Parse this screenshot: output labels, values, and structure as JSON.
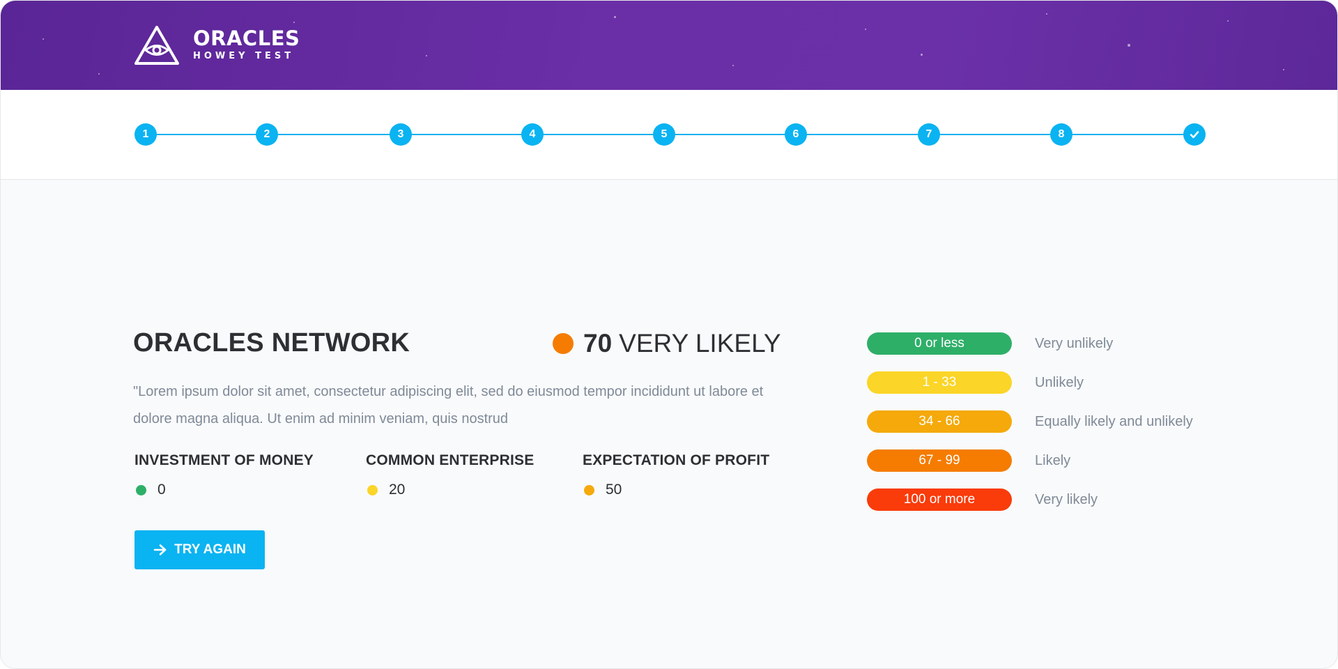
{
  "header": {
    "logo_title": "ORACLES",
    "logo_subtitle": "HOWEY TEST",
    "background_color": "#6a2ea6"
  },
  "stepper": {
    "steps": [
      "1",
      "2",
      "3",
      "4",
      "5",
      "6",
      "7",
      "8",
      "check-icon"
    ],
    "accent_color": "#0ab3f1"
  },
  "result": {
    "company": "ORACLES NETWORK",
    "score": "70",
    "verdict": "VERY LIKELY",
    "verdict_color": "#f57c00",
    "description": "\"Lorem ipsum dolor sit amet, consectetur adipiscing elit, sed do eiusmod tempor incididunt ut labore et dolore magna aliqua. Ut enim ad minim veniam, quis nostrud"
  },
  "criteria": [
    {
      "title": "INVESTMENT OF MONEY",
      "value": "0",
      "color": "#2eaf68"
    },
    {
      "title": "COMMON ENTERPRISE",
      "value": "20",
      "color": "#fbd527"
    },
    {
      "title": "EXPECTATION OF PROFIT",
      "value": "50",
      "color": "#f5a90a"
    }
  ],
  "try_again_label": "TRY AGAIN",
  "legend": [
    {
      "range": "0 or less",
      "label": "Very unlikely",
      "color": "#2eaf68"
    },
    {
      "range": "1 - 33",
      "label": "Unlikely",
      "color": "#fbd527"
    },
    {
      "range": "34 - 66",
      "label": "Equally likely and unlikely",
      "color": "#f5a90a"
    },
    {
      "range": "67 - 99",
      "label": "Likely",
      "color": "#f57c00"
    },
    {
      "range": "100 or more",
      "label": "Very likely",
      "color": "#fa3b0a"
    }
  ]
}
